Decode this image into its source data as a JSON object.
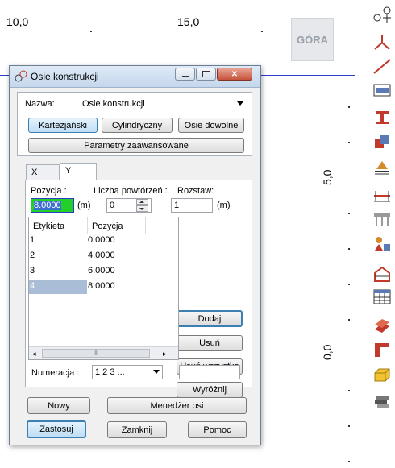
{
  "canvas": {
    "ruler_labels": [
      "10,0",
      "15,0"
    ],
    "side_labels": [
      "5,0",
      "0,0"
    ],
    "view_label": "GÓRA"
  },
  "toolbar": {
    "icons": [
      "axis-symbol-icon",
      "angle-icon",
      "line-icon",
      "section-icon",
      "i-beam-icon",
      "cube-icon",
      "support-icon",
      "dimension-icon",
      "grid-frame-icon",
      "load-icon",
      "structure-icon",
      "table-icon",
      "steel-profile-icon",
      "connection-icon",
      "box-icon",
      "layers-icon"
    ]
  },
  "dialog": {
    "title": "Osie konstrukcji",
    "name_label": "Nazwa:",
    "name_value": "Osie konstrukcji",
    "mode_buttons": [
      "Kartezjański",
      "Cylindryczny",
      "Osie dowolne"
    ],
    "advanced_button": "Parametry zaawansowane",
    "tabs": [
      "X",
      "Y"
    ],
    "position_label": "Pozycja :",
    "position_value": "8.0000",
    "unit_m": "(m)",
    "repeat_label": "Liczba powtórzeń :",
    "repeat_value": "0",
    "spacing_label": "Rozstaw:",
    "spacing_value": "1",
    "table": {
      "headers": [
        "Etykieta",
        "Pozycja"
      ],
      "rows": [
        {
          "label": "1",
          "position": "0.0000"
        },
        {
          "label": "2",
          "position": "4.0000"
        },
        {
          "label": "3",
          "position": "6.0000"
        },
        {
          "label": "4",
          "position": "8.0000"
        }
      ]
    },
    "scroll_grip": "III",
    "side_buttons": [
      "Dodaj",
      "Usuń",
      "Usuń wszystko",
      "Wyróżnij"
    ],
    "numbering_label": "Numeracja :",
    "numbering_value": "1 2 3 ...",
    "bottom_buttons": [
      "Nowy",
      "Menedżer osi"
    ],
    "action_buttons": [
      "Zastosuj",
      "Zamknij",
      "Pomoc"
    ]
  }
}
